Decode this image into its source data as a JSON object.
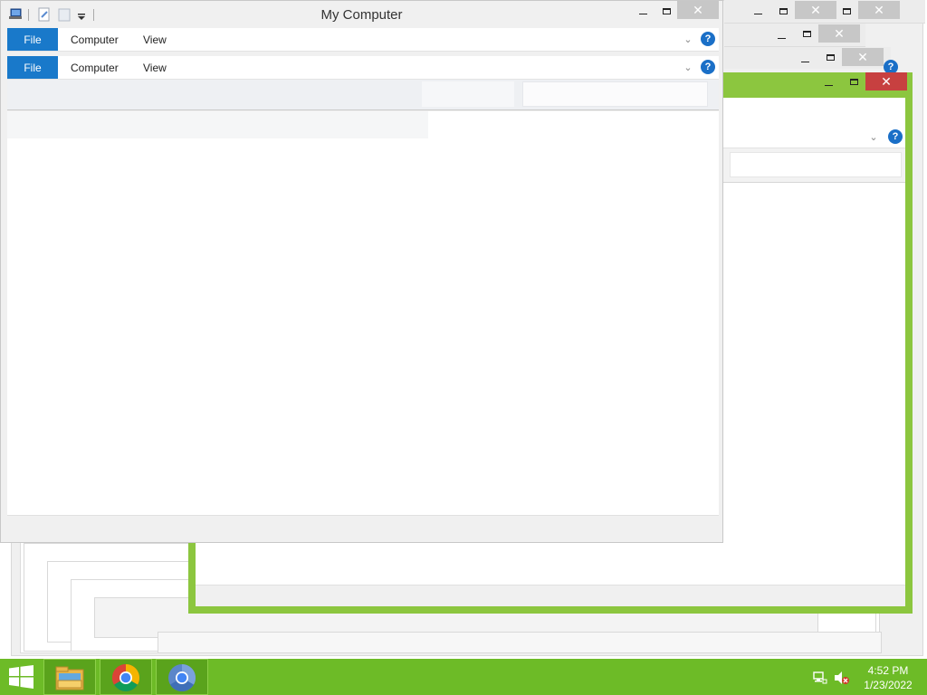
{
  "main_window": {
    "title": "My Computer",
    "ribbon_rows": [
      {
        "file": "File",
        "tabs": [
          "Computer",
          "View"
        ]
      },
      {
        "file": "File",
        "tabs": [
          "Computer",
          "View"
        ]
      }
    ],
    "help_glyph": "?",
    "caption": {
      "close": "✕"
    }
  },
  "background_windows": {
    "close_glyph": "✕",
    "active_border_color": "#8cc63f",
    "close_red": "#c74040"
  },
  "taskbar": {
    "color": "#6dbb27",
    "clock_time": "4:52 PM",
    "clock_date": "1/23/2022",
    "pinned": [
      "file-explorer-icon",
      "chrome-icon",
      "chrome-canary-icon"
    ]
  },
  "tray_icons": [
    "network-icon",
    "volume-muted-icon"
  ]
}
